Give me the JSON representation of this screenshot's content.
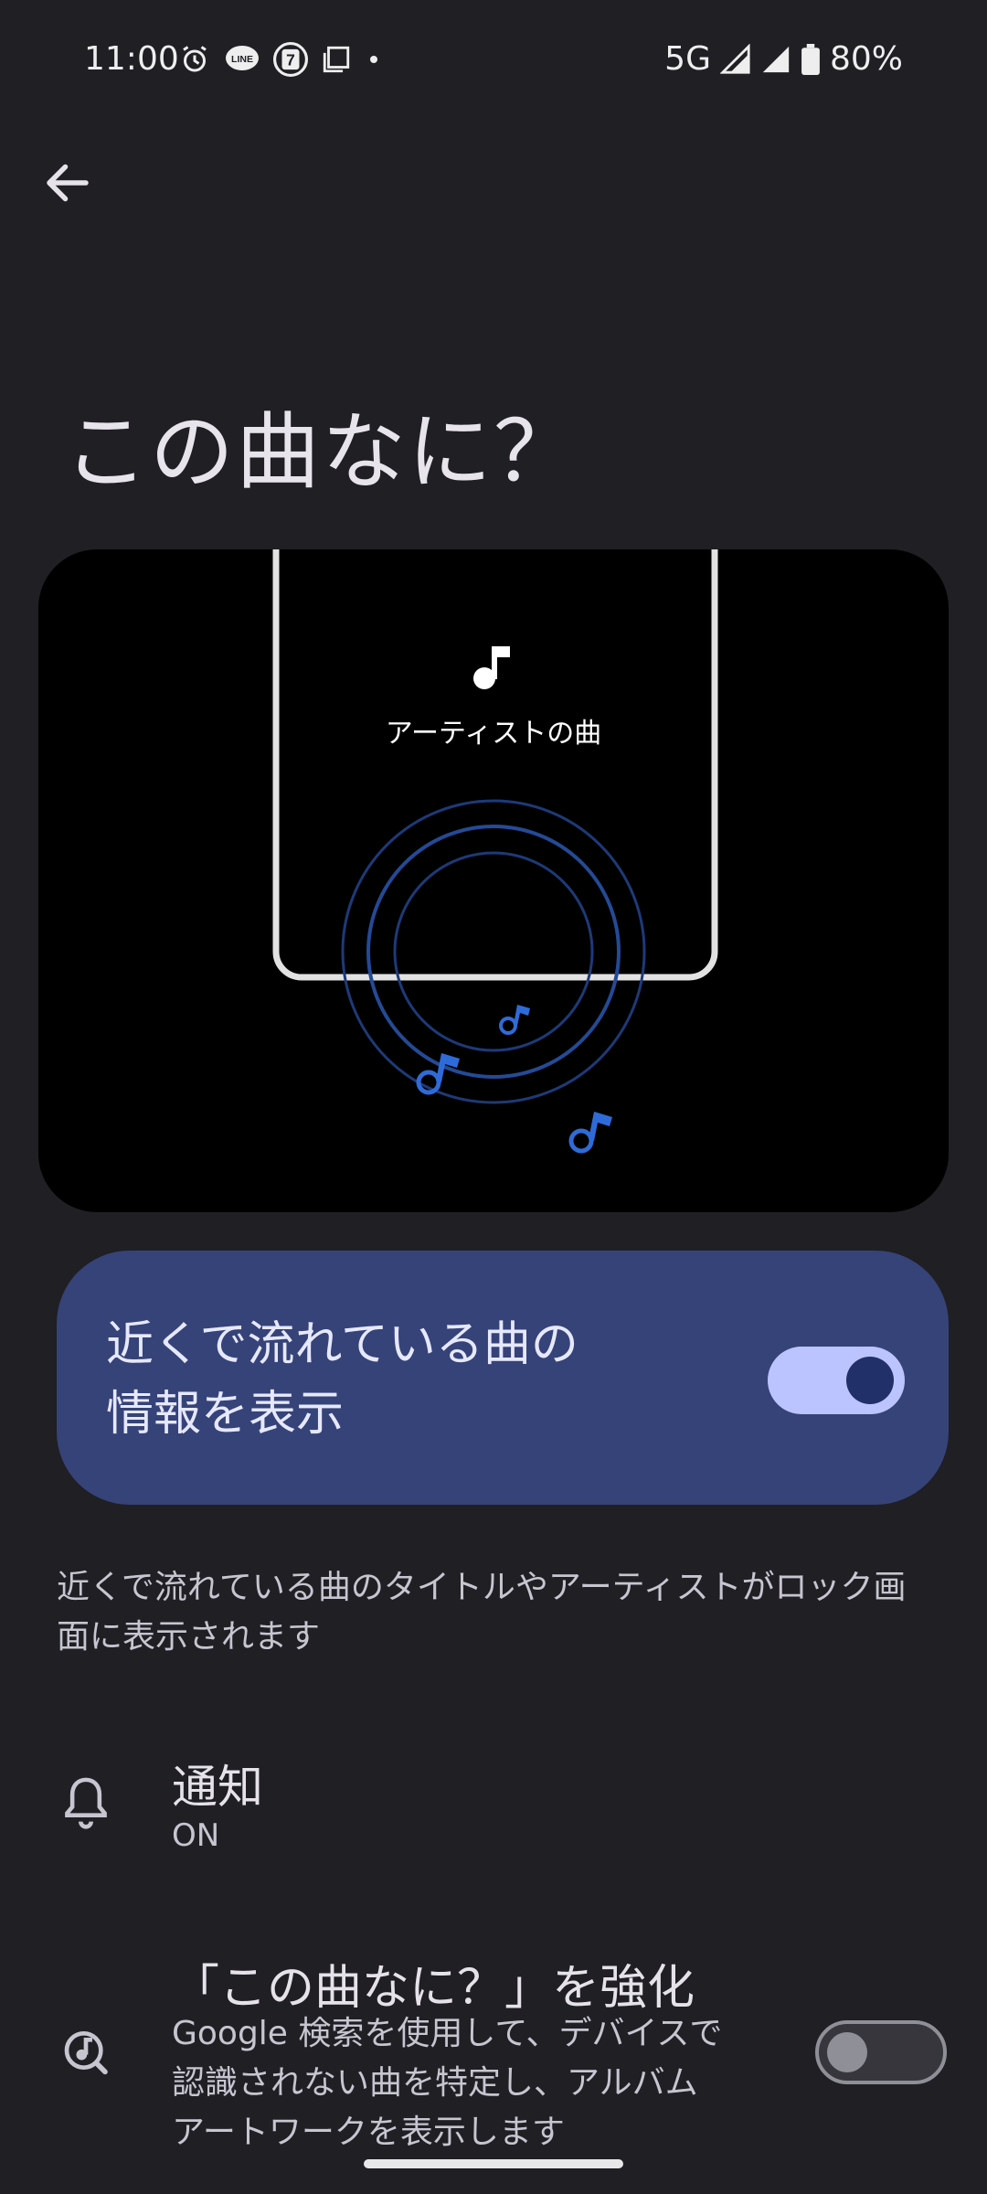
{
  "status_bar": {
    "time": "11:00",
    "network": "5G",
    "battery": "80%",
    "icons": [
      "alarm-icon",
      "line-app-icon",
      "seven-eleven-icon",
      "screenshot-icon",
      "dot-icon",
      "signal-icon",
      "signal-icon",
      "battery-icon"
    ]
  },
  "nav": {
    "back_icon": "arrow-left-icon"
  },
  "page": {
    "title": "この曲なに？"
  },
  "illustration": {
    "caption": "アーティストの曲",
    "accent_color": "#2f6bd8"
  },
  "main_toggle": {
    "label": "近くで流れている曲の情報を表示",
    "label_line1": "近くで流れている曲の",
    "label_line2": "情報を表示",
    "state": "on"
  },
  "description": "近くで流れている曲のタイトルやアーティストがロック画面に表示されます",
  "notification": {
    "icon": "bell-icon",
    "title": "通知",
    "value": "ON"
  },
  "enhance": {
    "icon": "music-search-icon",
    "title": "「この曲なに？」を強化",
    "subtitle": "Google 検索を使用して、デバイスで認識されない曲を特定し、アルバム アートワークを表示します",
    "subtitle_line1": "Google 検索を使用して、デバイスで",
    "subtitle_line2": "認識されない曲を特定し、アルバム",
    "subtitle_line3": "アートワークを表示します",
    "state": "off"
  },
  "colors": {
    "background": "#1f1f24",
    "card": "#364378",
    "switch_track_on": "#bcc4ff",
    "switch_knob_on": "#22306a"
  }
}
